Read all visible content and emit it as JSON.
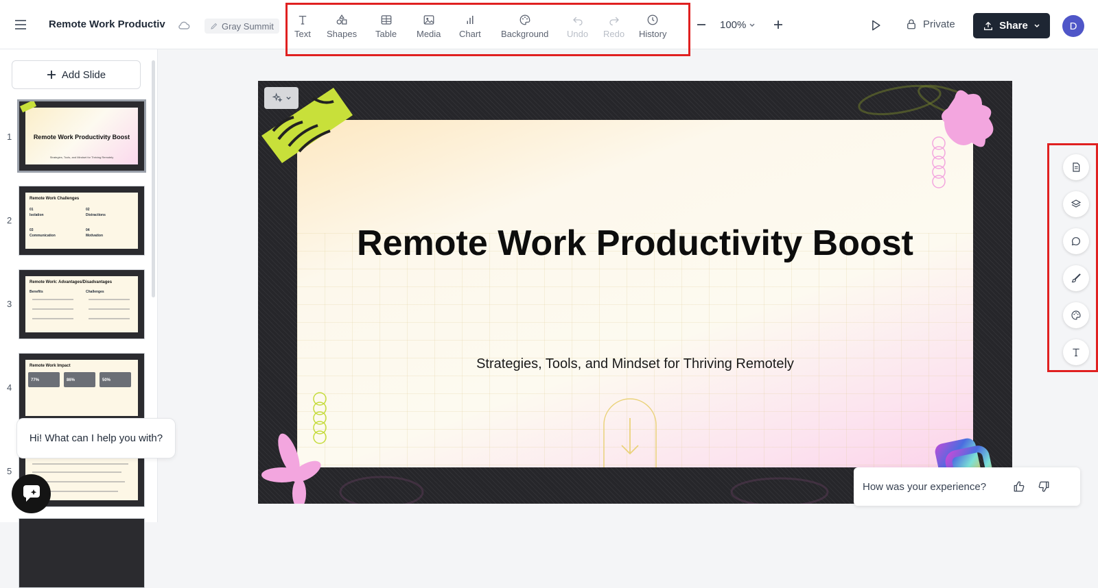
{
  "header": {
    "doc_title": "Remote Work Productivi",
    "theme_name": "Gray Summit",
    "zoom": "100%",
    "private_label": "Private",
    "share_label": "Share",
    "avatar_initial": "D"
  },
  "toolbar": [
    {
      "label": "Text",
      "icon": "text-icon"
    },
    {
      "label": "Shapes",
      "icon": "shapes-icon"
    },
    {
      "label": "Table",
      "icon": "table-icon"
    },
    {
      "label": "Media",
      "icon": "image-icon"
    },
    {
      "label": "Chart",
      "icon": "bar-chart-icon"
    },
    {
      "label": "Background",
      "icon": "palette-icon"
    },
    {
      "label": "Undo",
      "icon": "undo-icon",
      "disabled": true
    },
    {
      "label": "Redo",
      "icon": "redo-icon",
      "disabled": true
    },
    {
      "label": "History",
      "icon": "clock-icon"
    }
  ],
  "sidebar": {
    "add_slide_label": "Add Slide",
    "slides": [
      {
        "number": "1",
        "title": "Remote Work Productivity Boost",
        "subtitle": "Strategies, Tools, and Mindset for Thriving Remotely"
      },
      {
        "number": "2",
        "title": "Remote Work Challenges",
        "items": [
          "01",
          "Isolation",
          "02",
          "Distractions",
          "03",
          "Communication",
          "04",
          "Motivation"
        ]
      },
      {
        "number": "3",
        "title": "Remote Work: Advantages/Disadvantages",
        "columns": [
          "Benefits",
          "Challenges"
        ]
      },
      {
        "number": "4",
        "title": "Remote Work Impact",
        "stats": [
          "77%",
          "86%",
          "50%"
        ]
      },
      {
        "number": "5"
      }
    ]
  },
  "chat": {
    "bubble_text": "Hi! What can I help you with?"
  },
  "slide": {
    "title": "Remote Work Productivity Boost",
    "subtitle": "Strategies, Tools, and Mindset for Thriving Remotely"
  },
  "right_rail": [
    "notes-icon",
    "layers-icon",
    "comment-icon",
    "brush-icon",
    "palette-icon",
    "text-style-icon"
  ],
  "feedback": {
    "question": "How was your experience?"
  }
}
